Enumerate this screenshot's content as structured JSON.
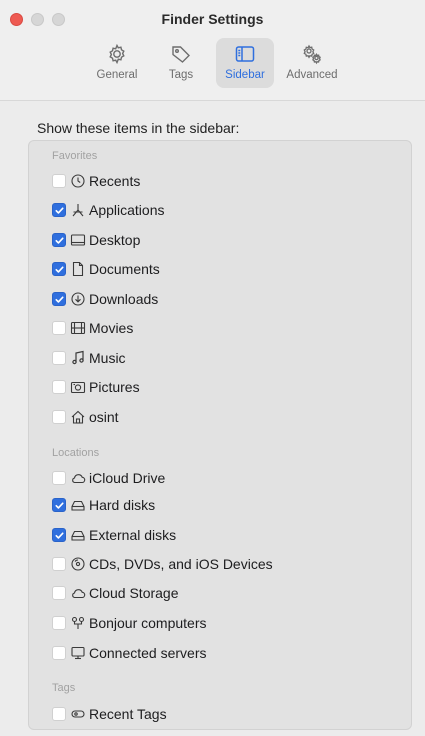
{
  "window": {
    "title": "Finder Settings"
  },
  "toolbar": {
    "tabs": [
      {
        "label": "General",
        "icon": "gear-icon",
        "selected": false
      },
      {
        "label": "Tags",
        "icon": "tag-icon",
        "selected": false
      },
      {
        "label": "Sidebar",
        "icon": "sidebar-icon",
        "selected": true
      },
      {
        "label": "Advanced",
        "icon": "gears-icon",
        "selected": false
      }
    ]
  },
  "main": {
    "heading": "Show these items in the sidebar:"
  },
  "sections": [
    {
      "title": "Favorites",
      "items": [
        {
          "label": "Recents",
          "checked": false,
          "icon": "clock-icon"
        },
        {
          "label": "Applications",
          "checked": true,
          "icon": "applications-icon"
        },
        {
          "label": "Desktop",
          "checked": true,
          "icon": "desktop-icon"
        },
        {
          "label": "Documents",
          "checked": true,
          "icon": "document-icon"
        },
        {
          "label": "Downloads",
          "checked": true,
          "icon": "download-icon"
        },
        {
          "label": "Movies",
          "checked": false,
          "icon": "film-icon"
        },
        {
          "label": "Music",
          "checked": false,
          "icon": "music-note-icon"
        },
        {
          "label": "Pictures",
          "checked": false,
          "icon": "camera-icon"
        },
        {
          "label": "osint",
          "checked": false,
          "icon": "home-icon"
        }
      ]
    },
    {
      "title": "Locations",
      "items": [
        {
          "label": "iCloud Drive",
          "checked": false,
          "icon": "cloud-icon"
        },
        {
          "label": "Hard disks",
          "checked": true,
          "icon": "hard-disk-icon"
        },
        {
          "label": "External disks",
          "checked": true,
          "icon": "external-disk-icon"
        },
        {
          "label": "CDs, DVDs, and iOS Devices",
          "checked": false,
          "icon": "disc-icon"
        },
        {
          "label": "Cloud Storage",
          "checked": false,
          "icon": "cloud-icon"
        },
        {
          "label": "Bonjour computers",
          "checked": false,
          "icon": "bonjour-icon"
        },
        {
          "label": "Connected servers",
          "checked": false,
          "icon": "server-icon"
        }
      ]
    },
    {
      "title": "Tags",
      "items": [
        {
          "label": "Recent Tags",
          "checked": false,
          "icon": "tags-icon"
        }
      ]
    }
  ],
  "colors": {
    "accent": "#2f6fde",
    "close": "#ee5a52"
  }
}
